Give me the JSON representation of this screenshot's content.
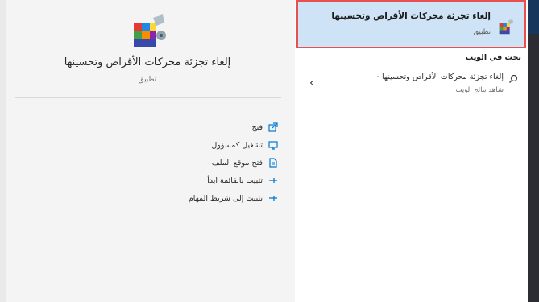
{
  "preview": {
    "title": "إلغاء تجزئة محركات الأقراص وتحسينها",
    "subtitle": "تطبيق",
    "actions": [
      {
        "label": "فتح",
        "icon": "open-icon"
      },
      {
        "label": "تشغيل كمسؤول",
        "icon": "run-as-admin-icon"
      },
      {
        "label": "فتح موقع الملف",
        "icon": "file-location-icon"
      },
      {
        "label": "تثبيت بالقائمة ابدأ",
        "icon": "pin-start-icon"
      },
      {
        "label": "تثبيت إلى شريط المهام",
        "icon": "pin-taskbar-icon"
      }
    ]
  },
  "results": {
    "best_match": {
      "title": "إلغاء تجزئة محركات الأقراص وتحسينها",
      "subtitle": "تطبيق",
      "icon": "defrag-app-icon"
    },
    "web_heading": "بحث في الويب",
    "web_item": {
      "title": "إلغاء تجزئة محركات الأقراص وتحسينها -",
      "subtitle": "شاهد نتائج الويب",
      "icon": "search-icon",
      "chevron": "chevron-left-icon"
    }
  },
  "colors": {
    "accent": "#0078d4",
    "selection": "#cfe3f6",
    "highlight_border": "#e8504f"
  }
}
